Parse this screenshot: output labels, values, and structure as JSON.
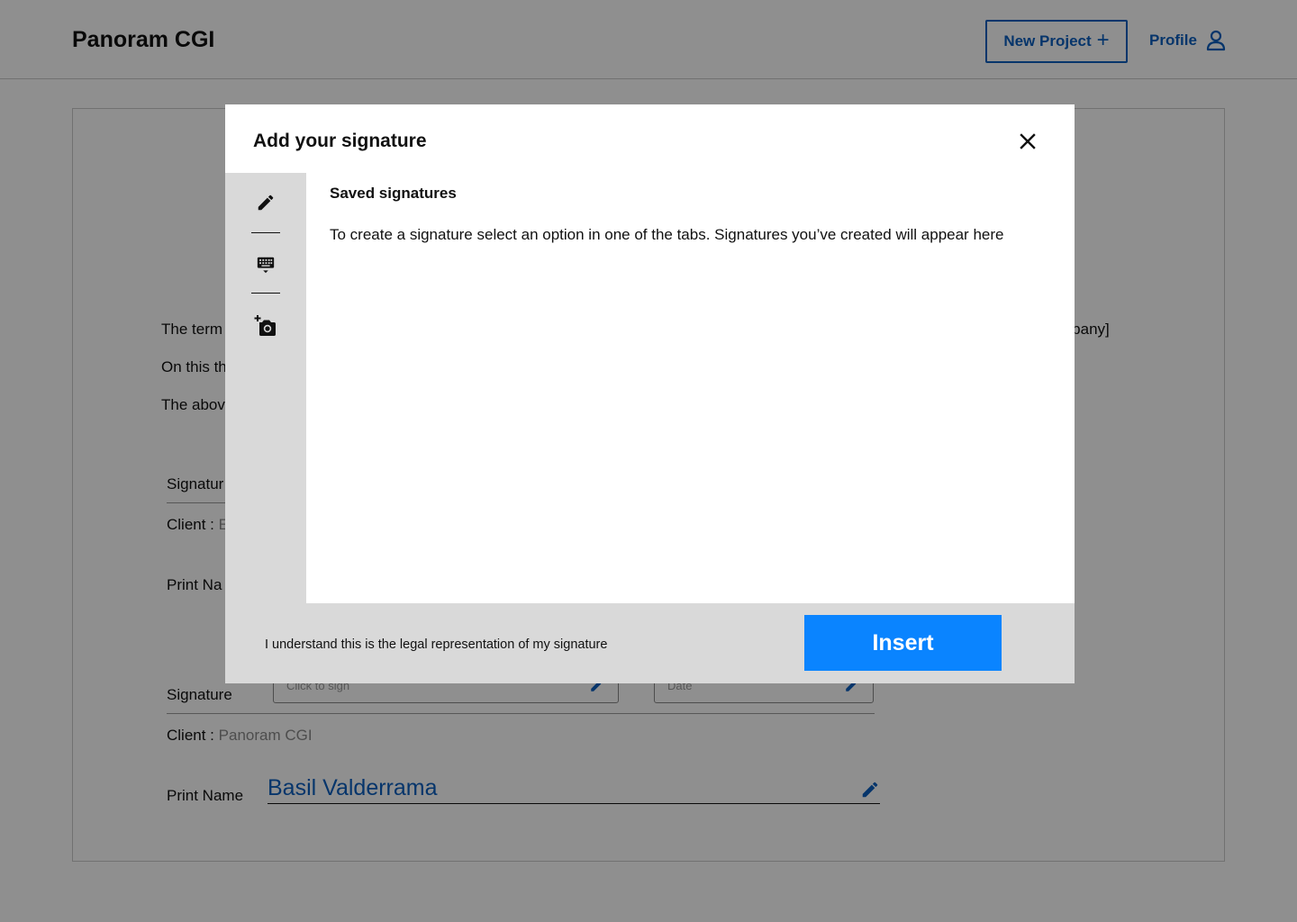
{
  "header": {
    "brand": "Panoram CGI",
    "new_project_label": "New Project",
    "profile_label": "Profile"
  },
  "document": {
    "line1_start": "The term",
    "line1_end": "mpany]",
    "line2_start": "On this th",
    "line3_start": "The abov",
    "block1": {
      "signature_label": "Signatur",
      "client_label": "Client :",
      "client_value": "E",
      "print_name_label": "Print Na"
    },
    "block2": {
      "signature_label": "Signature",
      "sign_placeholder": "Click to sign",
      "date_placeholder": "Date",
      "client_label": "Client :",
      "client_value": "Panoram CGI",
      "print_name_label": "Print Name",
      "print_name_value": "Basil Valderrama"
    }
  },
  "modal": {
    "title": "Add your signature",
    "tabs": [
      {
        "name": "draw",
        "icon": "pencil-icon"
      },
      {
        "name": "type",
        "icon": "keyboard-icon"
      },
      {
        "name": "upload",
        "icon": "add-photo-icon"
      }
    ],
    "saved_title": "Saved signatures",
    "saved_description": "To create a signature select an option in one of the tabs. Signatures you’ve created will appear here",
    "legal_text": "I understand this is the legal representation of my signature",
    "insert_label": "Insert"
  },
  "colors": {
    "accent": "#0b5fbf",
    "insert_button": "#0a84ff",
    "rail": "#d9d9d9"
  }
}
